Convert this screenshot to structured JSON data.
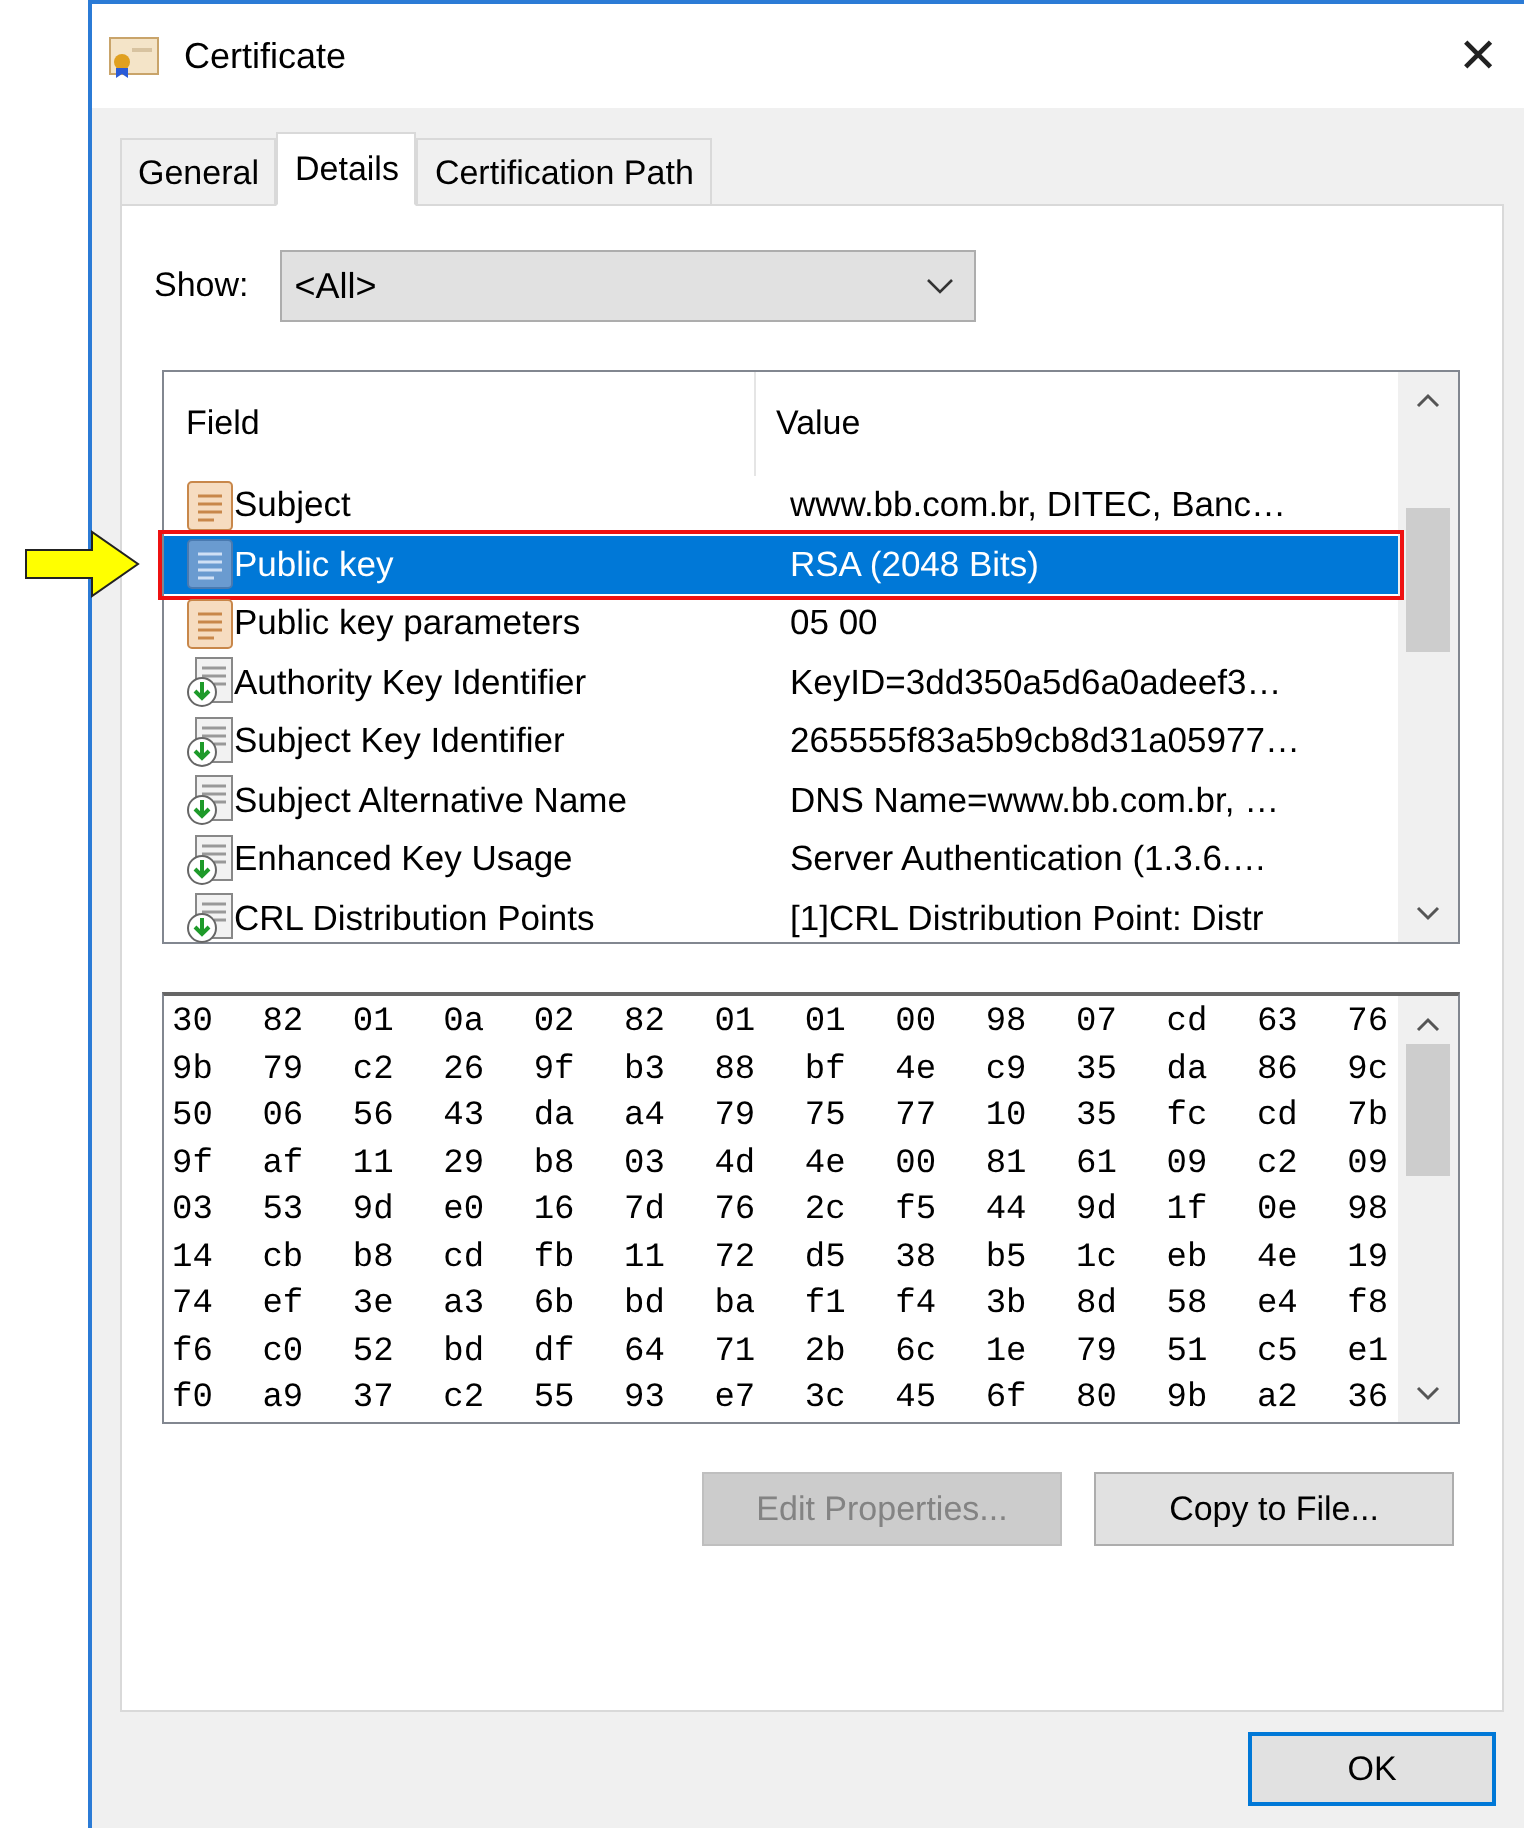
{
  "window": {
    "title": "Certificate",
    "close": "✕"
  },
  "tabs": [
    {
      "label": "General",
      "selected": false
    },
    {
      "label": "Details",
      "selected": true
    },
    {
      "label": "Certification Path",
      "selected": false
    }
  ],
  "show": {
    "label": "Show:",
    "value": "<All>"
  },
  "table": {
    "columns": [
      "Field",
      "Value"
    ],
    "rows": [
      {
        "kind": "cert",
        "field": "Subject",
        "value": "www.bb.com.br, DITEC, Banc…",
        "selected": false
      },
      {
        "kind": "cert",
        "field": "Public key",
        "value": "RSA (2048 Bits)",
        "selected": true,
        "annotated": true
      },
      {
        "kind": "cert",
        "field": "Public key parameters",
        "value": "05 00",
        "selected": false
      },
      {
        "kind": "ext",
        "field": "Authority Key Identifier",
        "value": "KeyID=3dd350a5d6a0adeef3…",
        "selected": false
      },
      {
        "kind": "ext",
        "field": "Subject Key Identifier",
        "value": "265555f83a5b9cb8d31a05977…",
        "selected": false
      },
      {
        "kind": "ext",
        "field": "Subject Alternative Name",
        "value": "DNS Name=www.bb.com.br, …",
        "selected": false
      },
      {
        "kind": "ext",
        "field": "Enhanced Key Usage",
        "value": "Server Authentication (1.3.6.…",
        "selected": false
      },
      {
        "kind": "ext",
        "field": "CRL Distribution Points",
        "value": "[1]CRL Distribution Point: Distr",
        "selected": false
      }
    ]
  },
  "hex_lines": [
    "30 82 01 0a 02 82 01 01 00 98 07 cd 63 76",
    "9b 79 c2 26 9f b3 88 bf 4e c9 35 da 86 9c",
    "50 06 56 43 da a4 79 75 77 10 35 fc cd 7b",
    "9f af 11 29 b8 03 4d 4e 00 81 61 09 c2 09",
    "03 53 9d e0 16 7d 76 2c f5 44 9d 1f 0e 98",
    "14 cb b8 cd fb 11 72 d5 38 b5 1c eb 4e 19",
    "74 ef 3e a3 6b bd ba f1 f4 3b 8d 58 e4 f8",
    "f6 c0 52 bd df 64 71 2b 6c 1e 79 51 c5 e1",
    "f0 a9 37 c2 55 93 e7 3c 45 6f 80 9b a2 36"
  ],
  "buttons": [
    {
      "label": "Edit Properties...",
      "disabled": true
    },
    {
      "label": "Copy to File...",
      "disabled": false
    }
  ],
  "footer_buttons": [
    {
      "label": "OK",
      "default": true
    }
  ]
}
